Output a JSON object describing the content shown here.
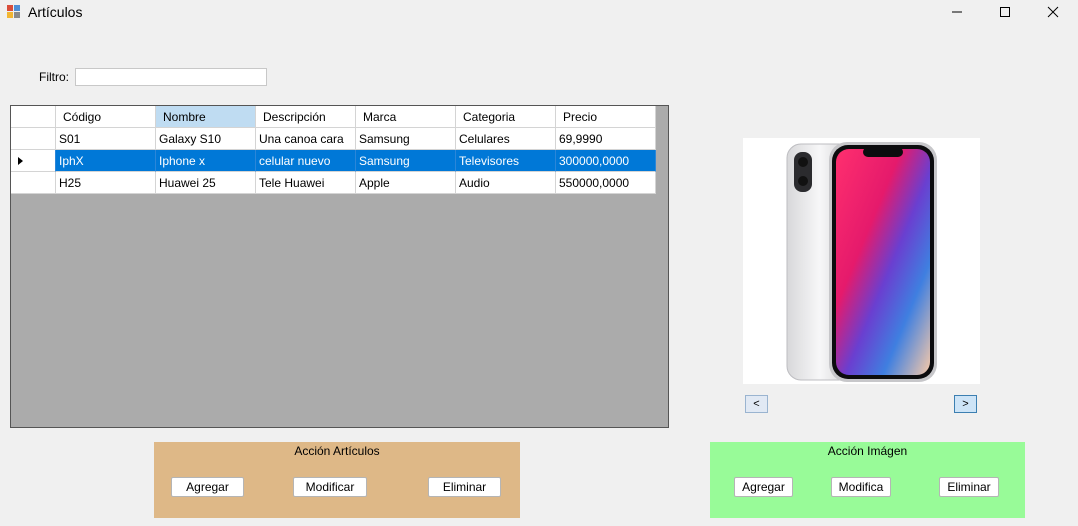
{
  "window": {
    "title": "Artículos",
    "minimize_label": "—",
    "maximize_label": "☐",
    "close_label": "✕",
    "icon": "app-form-icon"
  },
  "filter": {
    "label": "Filtro:",
    "value": ""
  },
  "grid": {
    "columns": [
      "Código",
      "Nombre",
      "Descripción",
      "Marca",
      "Categoria",
      "Precio"
    ],
    "sorted_column": "Nombre",
    "rows": [
      [
        "S01",
        "Galaxy S10",
        "Una canoa cara",
        "Samsung",
        "Celulares",
        "69,9990"
      ],
      [
        "IphX",
        "Iphone x",
        "celular nuevo",
        "Samsung",
        "Televisores",
        "300000,0000"
      ],
      [
        "H25",
        "Huawei 25",
        "Tele Huawei",
        "Apple",
        "Audio",
        "550000,0000"
      ]
    ],
    "selected_row": 1
  },
  "image_viewer": {
    "image": "iphone-x-image",
    "prev_label": "<",
    "next_label": ">"
  },
  "panel_articulos": {
    "title": "Acción Artículos",
    "add_label": "Agregar",
    "edit_label": "Modificar",
    "delete_label": "Eliminar",
    "color": "#deb887"
  },
  "panel_imagen": {
    "title": "Acción Imágen",
    "add_label": "Agregar",
    "edit_label": "Modifica",
    "delete_label": "Eliminar",
    "color": "#98fb98"
  }
}
